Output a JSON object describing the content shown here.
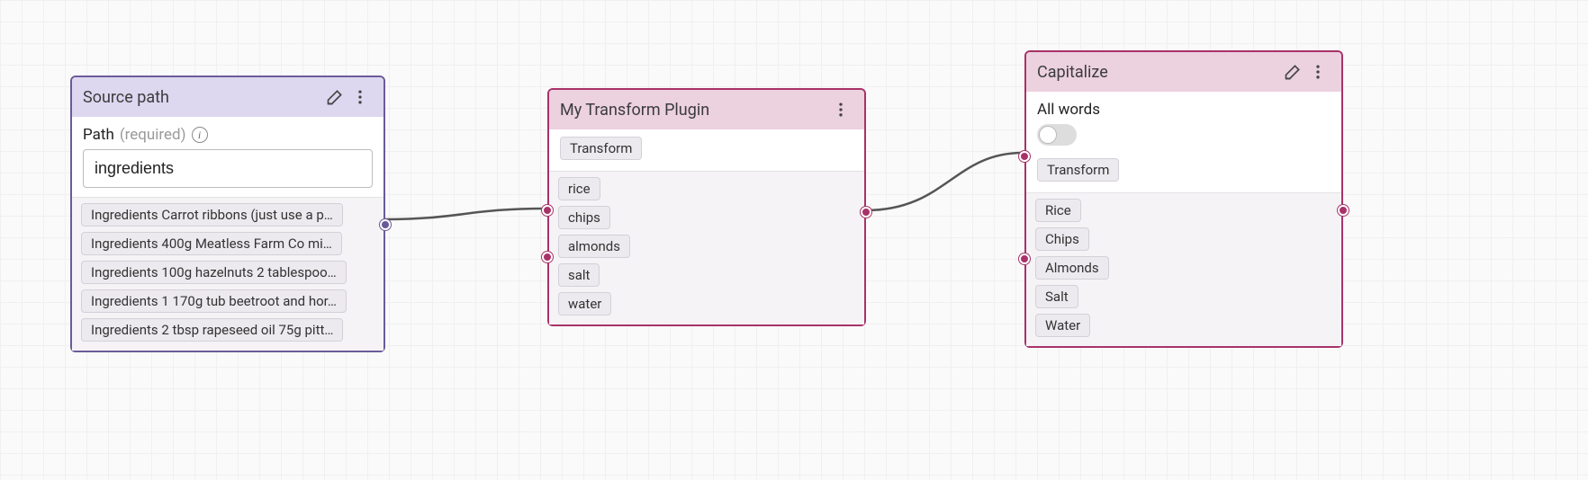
{
  "nodes": {
    "source": {
      "title": "Source path",
      "field_label": "Path",
      "required_label": "(required)",
      "input_value": "ingredients",
      "results": [
        "Ingredients Carrot ribbons (just use a p…",
        "Ingredients 400g Meatless Farm Co mi…",
        "Ingredients 100g hazelnuts 2 tablespoo…",
        "Ingredients 1 170g tub beetroot and hor…",
        "Ingredients 2 tbsp rapeseed oil 75g pitt…"
      ]
    },
    "transform": {
      "title": "My Transform Plugin",
      "badge": "Transform",
      "outputs": [
        "rice",
        "chips",
        "almonds",
        "salt",
        "water"
      ]
    },
    "capitalize": {
      "title": "Capitalize",
      "toggle_label": "All words",
      "toggle_on": false,
      "badge": "Transform",
      "outputs": [
        "Rice",
        "Chips",
        "Almonds",
        "Salt",
        "Water"
      ]
    }
  },
  "icons": {
    "edit": "pencil-icon",
    "menu": "kebab-menu-icon",
    "info": "info-icon"
  },
  "colors": {
    "purple": "#6a5b98",
    "pink": "#a83268"
  }
}
